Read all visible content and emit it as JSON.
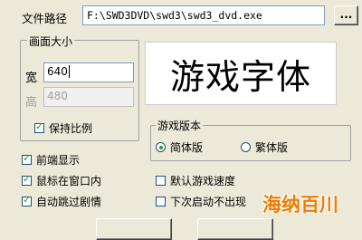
{
  "path": {
    "label": "文件路径",
    "value": "F:\\SWD3DVD\\swd3\\swd3_dvd.exe",
    "browse_label": "..."
  },
  "screen_size": {
    "title": "画面大小",
    "width_label": "宽",
    "width_value": "640",
    "height_label": "高",
    "height_value": "480",
    "keep_ratio_label": "保持比例"
  },
  "preview": {
    "text": "游戏字体"
  },
  "version": {
    "title": "游戏版本",
    "simplified_label": "简体版",
    "traditional_label": "繁体版"
  },
  "options": {
    "front_label": "前端显示",
    "mouse_in_window_label": "鼠标在窗口内",
    "auto_skip_label": "自动跳过剧情",
    "default_speed_label": "默认游戏速度",
    "next_launch_label": "下次启动不出现"
  },
  "watermark": {
    "text": "海纳百川"
  },
  "colors": {
    "watermark": "#f07c00",
    "check": "#21a121",
    "window_bg": "#ece9d8"
  }
}
